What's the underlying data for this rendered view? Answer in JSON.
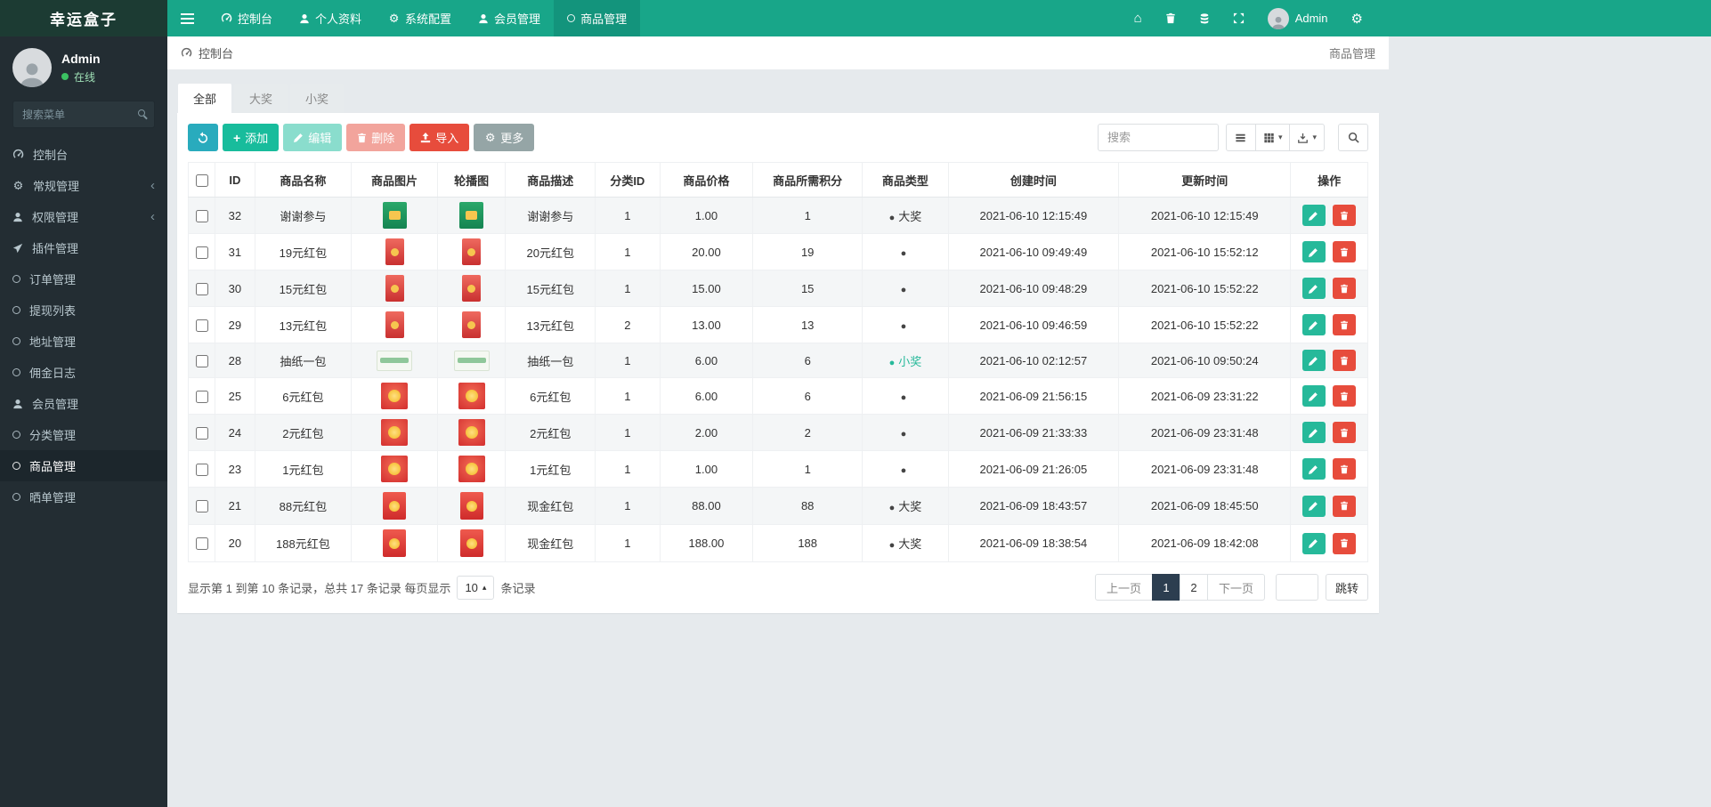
{
  "brand": {
    "title": "幸运盒子"
  },
  "icons": {
    "gear": "⚙",
    "home": "⌂",
    "caret_down": "▾",
    "caret_up": "▴",
    "chevron_left": "‹"
  },
  "topnav": {
    "items": [
      {
        "label": "控制台"
      },
      {
        "label": "个人资料"
      },
      {
        "label": "系统配置"
      },
      {
        "label": "会员管理"
      },
      {
        "label": "商品管理"
      }
    ],
    "user_name": "Admin"
  },
  "sidebar": {
    "user": {
      "name": "Admin",
      "status": "在线"
    },
    "search_placeholder": "搜索菜单",
    "items": [
      {
        "label": "控制台"
      },
      {
        "label": "常规管理"
      },
      {
        "label": "权限管理"
      },
      {
        "label": "插件管理"
      },
      {
        "label": "订单管理"
      },
      {
        "label": "提现列表"
      },
      {
        "label": "地址管理"
      },
      {
        "label": "佣金日志"
      },
      {
        "label": "会员管理"
      },
      {
        "label": "分类管理"
      },
      {
        "label": "商品管理"
      },
      {
        "label": "晒单管理"
      }
    ]
  },
  "breadcrumb": {
    "home": "控制台",
    "current": "商品管理"
  },
  "tabs": {
    "all": "全部",
    "big": "大奖",
    "small": "小奖"
  },
  "toolbar": {
    "add_label": "添加",
    "edit_label": "编辑",
    "delete_label": "删除",
    "import_label": "导入",
    "more_label": "更多",
    "search_placeholder": "搜索"
  },
  "table": {
    "columns": {
      "id": "ID",
      "name": "商品名称",
      "image": "商品图片",
      "carousel": "轮播图",
      "desc": "商品描述",
      "category": "分类ID",
      "price": "商品价格",
      "points": "商品所需积分",
      "type": "商品类型",
      "created": "创建时间",
      "updated": "更新时间",
      "ops": "操作"
    },
    "rows": [
      {
        "id": "32",
        "name": "谢谢参与",
        "image": "green-box",
        "carousel": "green-box",
        "desc": "谢谢参与",
        "category": "1",
        "price": "1.00",
        "points": "1",
        "type": "big",
        "type_label": "大奖",
        "created": "2021-06-10 12:15:49",
        "updated": "2021-06-10 12:15:49"
      },
      {
        "id": "31",
        "name": "19元红包",
        "image": "red",
        "carousel": "red",
        "desc": "20元红包",
        "category": "1",
        "price": "20.00",
        "points": "19",
        "type": "none",
        "type_label": "",
        "created": "2021-06-10 09:49:49",
        "updated": "2021-06-10 15:52:12"
      },
      {
        "id": "30",
        "name": "15元红包",
        "image": "red",
        "carousel": "red",
        "desc": "15元红包",
        "category": "1",
        "price": "15.00",
        "points": "15",
        "type": "none",
        "type_label": "",
        "created": "2021-06-10 09:48:29",
        "updated": "2021-06-10 15:52:22"
      },
      {
        "id": "29",
        "name": "13元红包",
        "image": "red",
        "carousel": "red",
        "desc": "13元红包",
        "category": "2",
        "price": "13.00",
        "points": "13",
        "type": "none",
        "type_label": "",
        "created": "2021-06-10 09:46:59",
        "updated": "2021-06-10 15:52:22"
      },
      {
        "id": "28",
        "name": "抽纸一包",
        "image": "tissue",
        "carousel": "tissue",
        "desc": "抽纸一包",
        "category": "1",
        "price": "6.00",
        "points": "6",
        "type": "small",
        "type_label": "小奖",
        "created": "2021-06-10 02:12:57",
        "updated": "2021-06-10 09:50:24"
      },
      {
        "id": "25",
        "name": "6元红包",
        "image": "red-gold",
        "carousel": "red-gold",
        "desc": "6元红包",
        "category": "1",
        "price": "6.00",
        "points": "6",
        "type": "none",
        "type_label": "",
        "created": "2021-06-09 21:56:15",
        "updated": "2021-06-09 23:31:22"
      },
      {
        "id": "24",
        "name": "2元红包",
        "image": "red-gold",
        "carousel": "red-gold",
        "desc": "2元红包",
        "category": "1",
        "price": "2.00",
        "points": "2",
        "type": "none",
        "type_label": "",
        "created": "2021-06-09 21:33:33",
        "updated": "2021-06-09 23:31:48"
      },
      {
        "id": "23",
        "name": "1元红包",
        "image": "red-gold",
        "carousel": "red-gold",
        "desc": "1元红包",
        "category": "1",
        "price": "1.00",
        "points": "1",
        "type": "none",
        "type_label": "",
        "created": "2021-06-09 21:26:05",
        "updated": "2021-06-09 23:31:48"
      },
      {
        "id": "21",
        "name": "88元红包",
        "image": "red-gold2",
        "carousel": "red-gold2",
        "desc": "现金红包",
        "category": "1",
        "price": "88.00",
        "points": "88",
        "type": "big",
        "type_label": "大奖",
        "created": "2021-06-09 18:43:57",
        "updated": "2021-06-09 18:45:50"
      },
      {
        "id": "20",
        "name": "188元红包",
        "image": "red-gold2",
        "carousel": "red-gold2",
        "desc": "现金红包",
        "category": "1",
        "price": "188.00",
        "points": "188",
        "type": "big",
        "type_label": "大奖",
        "created": "2021-06-09 18:38:54",
        "updated": "2021-06-09 18:42:08"
      }
    ]
  },
  "footer": {
    "info_prefix": "显示第 1 到第 10 条记录，总共 17 条记录 每页显示",
    "page_size": "10",
    "info_suffix": "条记录",
    "prev": "上一页",
    "page1": "1",
    "page2": "2",
    "next": "下一页",
    "jump_label": "跳转"
  }
}
